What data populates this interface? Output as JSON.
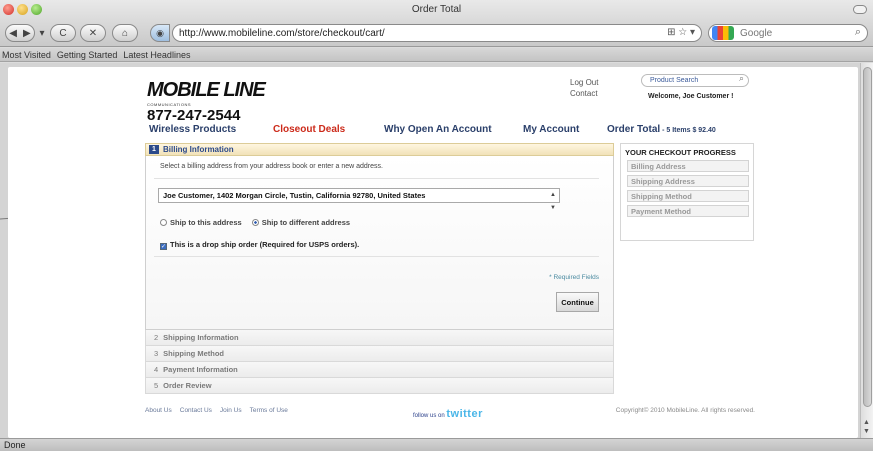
{
  "window": {
    "title": "Order Total"
  },
  "toolbar": {
    "back_icon": "◀",
    "forward_icon": "▶",
    "reload_icon": "C",
    "stop_icon": "✕",
    "home_icon": "⌂"
  },
  "address_bar": {
    "url": "http://www.mobileline.com/store/checkout/cart/",
    "right_icons": "⊞ ☆ ▾"
  },
  "browser_search": {
    "placeholder": "Google"
  },
  "bookmarks": [
    "Most Visited",
    "Getting Started",
    "Latest Headlines"
  ],
  "site": {
    "logo": "MOBILE LINE",
    "logo_sub": "COMMUNICATIONS",
    "phone": "877-247-2544",
    "login_link": "Log Out",
    "contact_link": "Contact",
    "product_search": "Product Search",
    "welcome": "Welcome, Joe Customer !"
  },
  "nav": {
    "wireless": "Wireless Products",
    "closeout": "Closeout Deals",
    "why_open": "Why Open An Account",
    "my_account": "My Account",
    "order_total": "Order Total",
    "order_total_sub": " - 5 Items $ 92.40"
  },
  "billing": {
    "number": "1",
    "title": "Billing Information",
    "instructions": "Select a billing address from your address book or enter a new address.",
    "address": "Joe Customer, 1402 Morgan Circle, Tustin, California 92780, United States",
    "ship_same": "Ship to this address",
    "ship_diff": "Ship to different address",
    "drop_ship": "This is a drop ship order (Required for USPS orders).",
    "required": "* Required Fields",
    "continue": "Continue"
  },
  "steps": [
    {
      "num": "2",
      "label": "Shipping Information"
    },
    {
      "num": "3",
      "label": "Shipping Method"
    },
    {
      "num": "4",
      "label": "Payment Information"
    },
    {
      "num": "5",
      "label": "Order Review"
    }
  ],
  "progress": {
    "title": "YOUR CHECKOUT PROGRESS",
    "items": [
      "Billing Address",
      "Shipping Address",
      "Shipping Method",
      "Payment Method"
    ]
  },
  "footer": {
    "links": [
      "About Us",
      "Contact Us",
      "Join Us",
      "Terms of Use"
    ],
    "follow": "follow us on",
    "twitter": "twitter",
    "copyright": "Copyright© 2010 MobileLine. All rights reserved."
  },
  "status": {
    "text": "Done"
  }
}
